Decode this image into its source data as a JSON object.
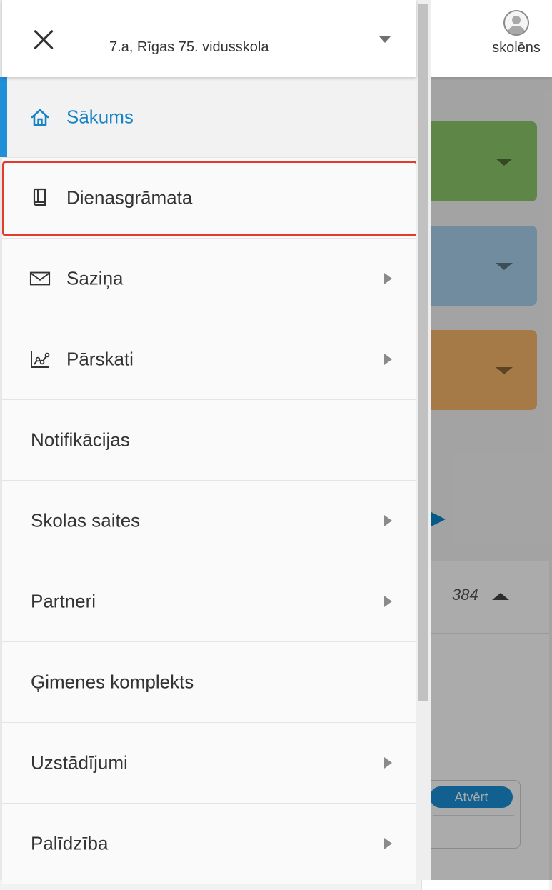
{
  "header": {
    "school_label": "7.a, Rīgas 75. vidusskola",
    "user_role": "skolēns"
  },
  "menu": {
    "items": [
      {
        "label": "Sākums",
        "icon": "home-icon",
        "active": true
      },
      {
        "label": "Dienasgrāmata",
        "icon": "book-icon",
        "highlighted": true
      },
      {
        "label": "Saziņa",
        "icon": "mail-icon",
        "has_submenu": true
      },
      {
        "label": "Pārskati",
        "icon": "chart-icon",
        "has_submenu": true
      },
      {
        "label": "Notifikācijas"
      },
      {
        "label": "Skolas saites",
        "has_submenu": true
      },
      {
        "label": "Partneri",
        "has_submenu": true
      },
      {
        "label": "Ģimenes komplekts"
      },
      {
        "label": "Uzstādījumi",
        "has_submenu": true
      },
      {
        "label": "Palīdzība",
        "has_submenu": true
      }
    ]
  },
  "background": {
    "count": "384",
    "open_button": "Atvērt"
  },
  "colors": {
    "accent": "#1f8fd8",
    "highlight_border": "#e33c2e",
    "card_green": "#8dc86a",
    "card_blue": "#a7d1ec",
    "card_orange": "#f7b66a"
  }
}
